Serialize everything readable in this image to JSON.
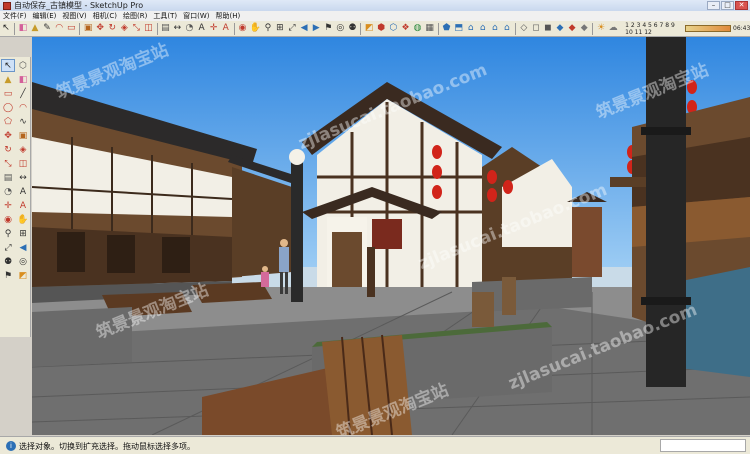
{
  "window": {
    "title": "自动保存_古镇模型 - SketchUp Pro",
    "controls": {
      "minimize": "–",
      "maximize": "□",
      "close": "✕"
    }
  },
  "menus": [
    {
      "label": "文件(F)"
    },
    {
      "label": "编辑(E)"
    },
    {
      "label": "视图(V)"
    },
    {
      "label": "相机(C)"
    },
    {
      "label": "绘图(R)"
    },
    {
      "label": "工具(T)"
    },
    {
      "label": "窗口(W)"
    },
    {
      "label": "帮助(H)"
    }
  ],
  "toolbar": {
    "icons": [
      {
        "name": "select-icon",
        "glyph": "↖",
        "color": "#222"
      },
      {
        "name": "eraser-icon",
        "glyph": "◧",
        "color": "#d4609a"
      },
      {
        "name": "paint-bucket-icon",
        "glyph": "▲",
        "color": "#c79b2b"
      },
      {
        "name": "pencil-icon",
        "glyph": "✎",
        "color": "#333"
      },
      {
        "name": "arc-icon",
        "glyph": "◠",
        "color": "#c0392b"
      },
      {
        "name": "rectangle-icon",
        "glyph": "▭",
        "color": "#c0392b"
      },
      {
        "name": "push-pull-icon",
        "glyph": "▣",
        "color": "#b5651d"
      },
      {
        "name": "move-icon",
        "glyph": "✥",
        "color": "#c0392b"
      },
      {
        "name": "rotate-icon",
        "glyph": "↻",
        "color": "#c0392b"
      },
      {
        "name": "follow-me-icon",
        "glyph": "◈",
        "color": "#c0392b"
      },
      {
        "name": "scale-icon",
        "glyph": "⤡",
        "color": "#c0392b"
      },
      {
        "name": "offset-icon",
        "glyph": "◫",
        "color": "#c0392b"
      },
      {
        "name": "tape-measure-icon",
        "glyph": "▤",
        "color": "#555"
      },
      {
        "name": "dimension-icon",
        "glyph": "↔",
        "color": "#333"
      },
      {
        "name": "protractor-icon",
        "glyph": "◔",
        "color": "#555"
      },
      {
        "name": "text-icon",
        "glyph": "A",
        "color": "#333"
      },
      {
        "name": "axes-icon",
        "glyph": "✛",
        "color": "#c0392b"
      },
      {
        "name": "3d-text-icon",
        "glyph": "A",
        "color": "#c0392b"
      },
      {
        "name": "orbit-icon",
        "glyph": "◉",
        "color": "#c0392b"
      },
      {
        "name": "pan-icon",
        "glyph": "✋",
        "color": "#c79b2b"
      },
      {
        "name": "zoom-icon",
        "glyph": "⚲",
        "color": "#333"
      },
      {
        "name": "zoom-window-icon",
        "glyph": "⊞",
        "color": "#333"
      },
      {
        "name": "zoom-extents-icon",
        "glyph": "⤢",
        "color": "#333"
      },
      {
        "name": "previous-view-icon",
        "glyph": "◀",
        "color": "#2c6fb5"
      },
      {
        "name": "next-view-icon",
        "glyph": "▶",
        "color": "#2c6fb5"
      },
      {
        "name": "walk-icon",
        "glyph": "⚑",
        "color": "#333"
      },
      {
        "name": "look-around-icon",
        "glyph": "◎",
        "color": "#333"
      },
      {
        "name": "position-camera-icon",
        "glyph": "⚉",
        "color": "#333"
      },
      {
        "name": "section-plane-icon",
        "glyph": "◩",
        "color": "#d98e1f"
      },
      {
        "name": "get-models-icon",
        "glyph": "⬢",
        "color": "#c0392b"
      },
      {
        "name": "share-model-icon",
        "glyph": "⬡",
        "color": "#2c6fb5"
      },
      {
        "name": "components-icon",
        "glyph": "❖",
        "color": "#c0392b"
      },
      {
        "name": "materials-icon",
        "glyph": "◍",
        "color": "#2c8a3e"
      },
      {
        "name": "styles-icon",
        "glyph": "▦",
        "color": "#555"
      },
      {
        "name": "iso-view-icon",
        "glyph": "⬟",
        "color": "#2c6fb5"
      },
      {
        "name": "top-view-icon",
        "glyph": "⬒",
        "color": "#2c6fb5"
      },
      {
        "name": "front-view-icon",
        "glyph": "⌂",
        "color": "#2c6fb5"
      },
      {
        "name": "right-view-icon",
        "glyph": "⌂",
        "color": "#2c6fb5"
      },
      {
        "name": "back-view-icon",
        "glyph": "⌂",
        "color": "#2c6fb5"
      },
      {
        "name": "left-view-icon",
        "glyph": "⌂",
        "color": "#2c6fb5"
      },
      {
        "name": "xray-icon",
        "glyph": "◇",
        "color": "#555"
      },
      {
        "name": "wireframe-icon",
        "glyph": "◻",
        "color": "#555"
      },
      {
        "name": "hidden-line-icon",
        "glyph": "◼",
        "color": "#555"
      },
      {
        "name": "shaded-icon",
        "glyph": "◆",
        "color": "#2c6fb5"
      },
      {
        "name": "shaded-textures-icon",
        "glyph": "◆",
        "color": "#c0392b"
      },
      {
        "name": "monochrome-icon",
        "glyph": "◆",
        "color": "#777"
      },
      {
        "name": "shadows-icon",
        "glyph": "☀",
        "color": "#d98e1f"
      },
      {
        "name": "fog-icon",
        "glyph": "☁",
        "color": "#777"
      }
    ],
    "shadow_ruler": {
      "start": "1 2 3 4 5 6 7 8 9 10 11 12",
      "time": "06:43"
    }
  },
  "left_tools": [
    {
      "name": "select-icon",
      "glyph": "↖",
      "color": "#222",
      "active": true
    },
    {
      "name": "make-component-icon",
      "glyph": "⬡",
      "color": "#555",
      "active": false
    },
    {
      "name": "paint-bucket-icon",
      "glyph": "▲",
      "color": "#c79b2b",
      "active": false
    },
    {
      "name": "eraser-icon",
      "glyph": "◧",
      "color": "#d4609a",
      "active": false
    },
    {
      "name": "rectangle-icon",
      "glyph": "▭",
      "color": "#c0392b",
      "active": false
    },
    {
      "name": "line-icon",
      "glyph": "╱",
      "color": "#333",
      "active": false
    },
    {
      "name": "circle-icon",
      "glyph": "◯",
      "color": "#c0392b",
      "active": false
    },
    {
      "name": "arc-icon",
      "glyph": "◠",
      "color": "#c0392b",
      "active": false
    },
    {
      "name": "polygon-icon",
      "glyph": "⬠",
      "color": "#c0392b",
      "active": false
    },
    {
      "name": "freehand-icon",
      "glyph": "∿",
      "color": "#333",
      "active": false
    },
    {
      "name": "move-icon",
      "glyph": "✥",
      "color": "#c0392b",
      "active": false
    },
    {
      "name": "push-pull-icon",
      "glyph": "▣",
      "color": "#b5651d",
      "active": false
    },
    {
      "name": "rotate-icon",
      "glyph": "↻",
      "color": "#c0392b",
      "active": false
    },
    {
      "name": "follow-me-icon",
      "glyph": "◈",
      "color": "#c0392b",
      "active": false
    },
    {
      "name": "scale-icon",
      "glyph": "⤡",
      "color": "#c0392b",
      "active": false
    },
    {
      "name": "offset-icon",
      "glyph": "◫",
      "color": "#c0392b",
      "active": false
    },
    {
      "name": "tape-measure-icon",
      "glyph": "▤",
      "color": "#555",
      "active": false
    },
    {
      "name": "dimension-icon",
      "glyph": "↔",
      "color": "#333",
      "active": false
    },
    {
      "name": "protractor-icon",
      "glyph": "◔",
      "color": "#555",
      "active": false
    },
    {
      "name": "text-icon",
      "glyph": "A",
      "color": "#333",
      "active": false
    },
    {
      "name": "axes-icon",
      "glyph": "✛",
      "color": "#c0392b",
      "active": false
    },
    {
      "name": "3d-text-icon",
      "glyph": "A",
      "color": "#c0392b",
      "active": false
    },
    {
      "name": "orbit-icon",
      "glyph": "◉",
      "color": "#c0392b",
      "active": false
    },
    {
      "name": "pan-icon",
      "glyph": "✋",
      "color": "#c79b2b",
      "active": false
    },
    {
      "name": "zoom-icon",
      "glyph": "⚲",
      "color": "#333",
      "active": false
    },
    {
      "name": "zoom-window-icon",
      "glyph": "⊞",
      "color": "#333",
      "active": false
    },
    {
      "name": "zoom-extents-icon",
      "glyph": "⤢",
      "color": "#333",
      "active": false
    },
    {
      "name": "previous-view-icon",
      "glyph": "◀",
      "color": "#2c6fb5",
      "active": false
    },
    {
      "name": "position-camera-icon",
      "glyph": "⚉",
      "color": "#333",
      "active": false
    },
    {
      "name": "look-around-icon",
      "glyph": "◎",
      "color": "#333",
      "active": false
    },
    {
      "name": "walk-icon",
      "glyph": "⚑",
      "color": "#333",
      "active": false
    },
    {
      "name": "section-plane-icon",
      "glyph": "◩",
      "color": "#d98e1f",
      "active": false
    }
  ],
  "status": {
    "icon": "i",
    "text": "选择对象。切换到扩充选择。拖动鼠标选择多项。"
  },
  "watermarks": [
    "筑景景观淘宝站",
    "zjlasucai.taobao.com",
    "筑景景观淘宝站",
    "zjlasucai.taobao.com",
    "筑景景观淘宝站",
    "zjlasucai.taobao.com",
    "筑景景观淘宝站"
  ],
  "colors": {
    "sky_top": "#2f86e0",
    "sky_bottom": "#a9d4f6",
    "wood": "#6b4a2e",
    "dark_wood": "#3c2a1c",
    "plaster": "#f2efe6",
    "pavement": "#8a8a8a",
    "lantern": "#d1241a"
  }
}
